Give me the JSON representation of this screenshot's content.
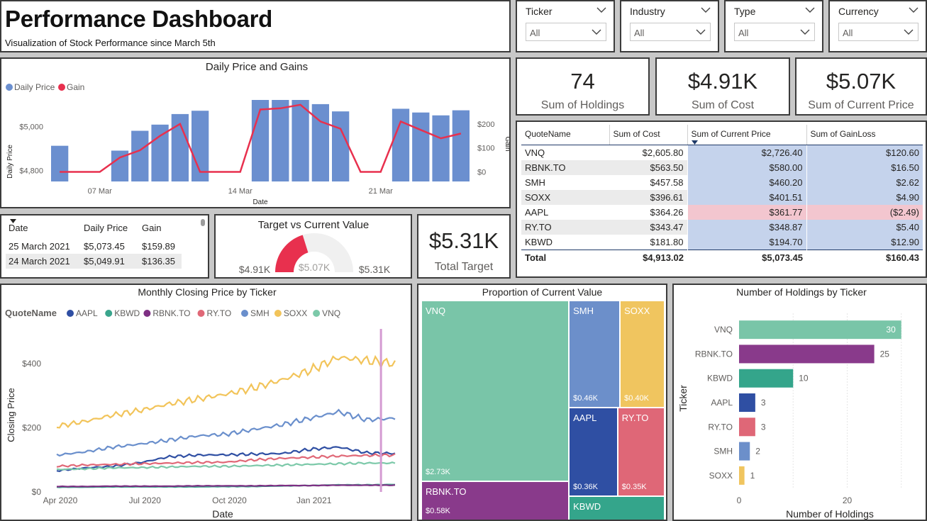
{
  "header": {
    "title": "Performance Dashboard",
    "subtitle": "Visualization of Stock Performance since March 5th"
  },
  "slicers": [
    {
      "label": "Ticker",
      "value": "All"
    },
    {
      "label": "Industry",
      "value": "All"
    },
    {
      "label": "Type",
      "value": "All"
    },
    {
      "label": "Currency",
      "value": "All"
    }
  ],
  "kpis": [
    {
      "value": "74",
      "label": "Sum of Holdings"
    },
    {
      "value": "$4.91K",
      "label": "Sum of Cost"
    },
    {
      "value": "$5.07K",
      "label": "Sum of Current Price"
    }
  ],
  "total_target": {
    "value": "$5.31K",
    "label": "Total Target"
  },
  "matrix": {
    "headers": [
      "QuoteName",
      "Sum of Cost",
      "Sum of Current Price",
      "Sum of GainLoss"
    ],
    "rows": [
      {
        "name": "VNQ",
        "cost": "$2,605.80",
        "current": "$2,726.40",
        "gain": "$120.60",
        "state": "up"
      },
      {
        "name": "RBNK.TO",
        "cost": "$563.50",
        "current": "$580.00",
        "gain": "$16.50",
        "state": "up"
      },
      {
        "name": "SMH",
        "cost": "$457.58",
        "current": "$460.20",
        "gain": "$2.62",
        "state": "up"
      },
      {
        "name": "SOXX",
        "cost": "$396.61",
        "current": "$401.51",
        "gain": "$4.90",
        "state": "up"
      },
      {
        "name": "AAPL",
        "cost": "$364.26",
        "current": "$361.77",
        "gain": "($2.49)",
        "state": "down"
      },
      {
        "name": "RY.TO",
        "cost": "$343.47",
        "current": "$348.87",
        "gain": "$5.40",
        "state": "up"
      },
      {
        "name": "KBWD",
        "cost": "$181.80",
        "current": "$194.70",
        "gain": "$12.90",
        "state": "up"
      }
    ],
    "total": {
      "name": "Total",
      "cost": "$4,913.02",
      "current": "$5,073.45",
      "gain": "$160.43"
    }
  },
  "daily_table": {
    "headers": [
      "Date",
      "Daily Price",
      "Gain"
    ],
    "rows": [
      {
        "date": "25 March 2021",
        "price": "$5,073.45",
        "gain": "$159.89"
      },
      {
        "date": "24 March 2021",
        "price": "$5,049.91",
        "gain": "$136.35"
      }
    ]
  },
  "chart_data": [
    {
      "type": "bar",
      "title": "Daily Price and Gains",
      "legend": [
        "Daily Price",
        "Gain"
      ],
      "legend_placement": "top-left",
      "xlabel": "Date",
      "ylabel": "Daily Price",
      "y2label": "Gain",
      "x_ticks": [
        "07 Mar",
        "14 Mar",
        "21 Mar"
      ],
      "y_ticks": [
        "$4,800",
        "$5,000"
      ],
      "y2_ticks": [
        "$0",
        "$100",
        "$200"
      ],
      "ylim": [
        4750,
        5120
      ],
      "y2lim": [
        -40,
        300
      ],
      "categories": [
        "05 Mar",
        "06 Mar",
        "07 Mar",
        "08 Mar",
        "09 Mar",
        "10 Mar",
        "11 Mar",
        "12 Mar",
        "13 Mar",
        "14 Mar",
        "15 Mar",
        "16 Mar",
        "17 Mar",
        "18 Mar",
        "19 Mar",
        "20 Mar",
        "21 Mar",
        "22 Mar",
        "23 Mar",
        "24 Mar",
        "25 Mar"
      ],
      "series": [
        {
          "name": "Daily Price",
          "kind": "bar",
          "values": [
            4912,
            null,
            null,
            4890,
            4980,
            5008,
            5056,
            5071,
            null,
            null,
            5123,
            5123,
            5123,
            5101,
            5068,
            null,
            null,
            5080,
            5063,
            5050,
            5073
          ]
        },
        {
          "name": "Gain",
          "kind": "line",
          "values": [
            0,
            0,
            0,
            60,
            90,
            150,
            200,
            0,
            0,
            0,
            260,
            265,
            280,
            210,
            180,
            0,
            0,
            210,
            175,
            140,
            160
          ]
        }
      ],
      "colors": {
        "bar": "#6b8fcf",
        "line": "#e8304e"
      }
    },
    {
      "type": "gauge",
      "title": "Target vs Current Value",
      "min_label": "$4.91K",
      "max_label": "$5.31K",
      "value_label": "$5.07K",
      "min": 4913.02,
      "max": 5310,
      "value": 5073.45,
      "colors": {
        "fill": "#e8304e",
        "track": "#f0f0f0"
      }
    },
    {
      "type": "line",
      "title": "Monthly Closing Price by Ticker",
      "xlabel": "Date",
      "ylabel": "Closing Price",
      "legend_title": "QuoteName",
      "legend_placement": "top-left",
      "x_ticks": [
        "Apr 2020",
        "Jul 2020",
        "Oct 2020",
        "Jan 2021"
      ],
      "y_ticks": [
        "$0",
        "$200",
        "$400"
      ],
      "ylim": [
        0,
        480
      ],
      "x_months": [
        0,
        1,
        2,
        3,
        4,
        5,
        6,
        7,
        8,
        9,
        10,
        11,
        12
      ],
      "marker_month": 11.5,
      "series": [
        {
          "name": "AAPL",
          "color": "#2f4fa3",
          "values": [
            66,
            75,
            80,
            92,
            110,
            115,
            116,
            118,
            120,
            133,
            140,
            122,
            120
          ]
        },
        {
          "name": "KBWD",
          "color": "#3aa58c",
          "values": [
            15,
            15,
            16,
            16,
            16,
            16,
            17,
            17,
            19,
            20,
            22,
            22,
            23
          ]
        },
        {
          "name": "RBNK.TO",
          "color": "#7e2f83",
          "values": [
            17,
            17,
            18,
            18,
            18,
            19,
            19,
            19,
            20,
            20,
            21,
            21,
            21
          ]
        },
        {
          "name": "RY.TO",
          "color": "#e06877",
          "values": [
            80,
            84,
            86,
            88,
            90,
            92,
            93,
            100,
            105,
            108,
            112,
            114,
            115
          ]
        },
        {
          "name": "SMH",
          "color": "#6a8fcc",
          "values": [
            115,
            125,
            140,
            150,
            162,
            175,
            180,
            195,
            210,
            230,
            250,
            225,
            230
          ]
        },
        {
          "name": "SOXX",
          "color": "#f2c45a",
          "values": [
            205,
            220,
            240,
            255,
            275,
            290,
            305,
            325,
            350,
            380,
            420,
            410,
            400
          ]
        },
        {
          "name": "VNQ",
          "color": "#7cc9a9",
          "values": [
            70,
            72,
            75,
            76,
            78,
            80,
            80,
            82,
            84,
            86,
            88,
            90,
            90
          ]
        }
      ]
    },
    {
      "type": "treemap",
      "title": "Proportion of Current Value",
      "items": [
        {
          "name": "VNQ",
          "label": "$2.73K",
          "value": 2726.4,
          "color": "#79c5a8"
        },
        {
          "name": "RBNK.TO",
          "label": "$0.58K",
          "value": 580.0,
          "color": "#893a8b"
        },
        {
          "name": "SMH",
          "label": "$0.46K",
          "value": 460.2,
          "color": "#6c8fca"
        },
        {
          "name": "SOXX",
          "label": "$0.40K",
          "value": 401.51,
          "color": "#f0c55f"
        },
        {
          "name": "AAPL",
          "label": "$0.36K",
          "value": 361.77,
          "color": "#2f4fa3"
        },
        {
          "name": "RY.TO",
          "label": "$0.35K",
          "value": 348.87,
          "color": "#df6777"
        },
        {
          "name": "KBWD",
          "label": "",
          "value": 194.7,
          "color": "#34a58b"
        }
      ]
    },
    {
      "type": "bar",
      "orientation": "horizontal",
      "title": "Number of Holdings by Ticker",
      "xlabel": "Number of Holdings",
      "ylabel": "Ticker",
      "x_ticks": [
        "0",
        "20"
      ],
      "xlim": [
        0,
        32
      ],
      "categories": [
        "VNQ",
        "RBNK.TO",
        "KBWD",
        "AAPL",
        "RY.TO",
        "SMH",
        "SOXX"
      ],
      "values": [
        30,
        25,
        10,
        3,
        3,
        2,
        1
      ],
      "colors": [
        "#79c5a8",
        "#893a8b",
        "#34a58b",
        "#2f4fa3",
        "#df6777",
        "#6c8fca",
        "#f0c55f"
      ]
    }
  ]
}
